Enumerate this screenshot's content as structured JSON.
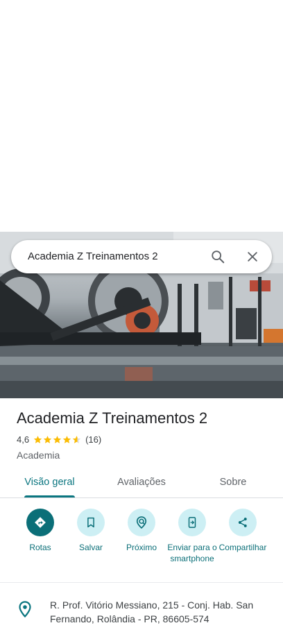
{
  "search": {
    "query": "Academia Z Treinamentos 2"
  },
  "place": {
    "name": "Academia Z Treinamentos 2",
    "rating": "4,6",
    "rating_value": 4.6,
    "review_count": "(16)",
    "category": "Academia"
  },
  "tabs": [
    {
      "label": "Visão geral",
      "active": true
    },
    {
      "label": "Avaliações",
      "active": false
    },
    {
      "label": "Sobre",
      "active": false
    }
  ],
  "actions": [
    {
      "label": "Rotas",
      "icon": "directions-icon"
    },
    {
      "label": "Salvar",
      "icon": "bookmark-icon"
    },
    {
      "label": "Próximo",
      "icon": "nearby-icon"
    },
    {
      "label": "Enviar para o smartphone",
      "icon": "send-to-phone-icon"
    },
    {
      "label": "Compartilhar",
      "icon": "share-icon"
    }
  ],
  "address": {
    "text": "R. Prof. Vitório Messiano, 215 - Conj. Hab. San Fernando, Rolândia - PR, 86605-574"
  },
  "colors": {
    "accent": "#0b6f78",
    "accent_light": "#cdeff4",
    "star": "#fbbc04"
  }
}
